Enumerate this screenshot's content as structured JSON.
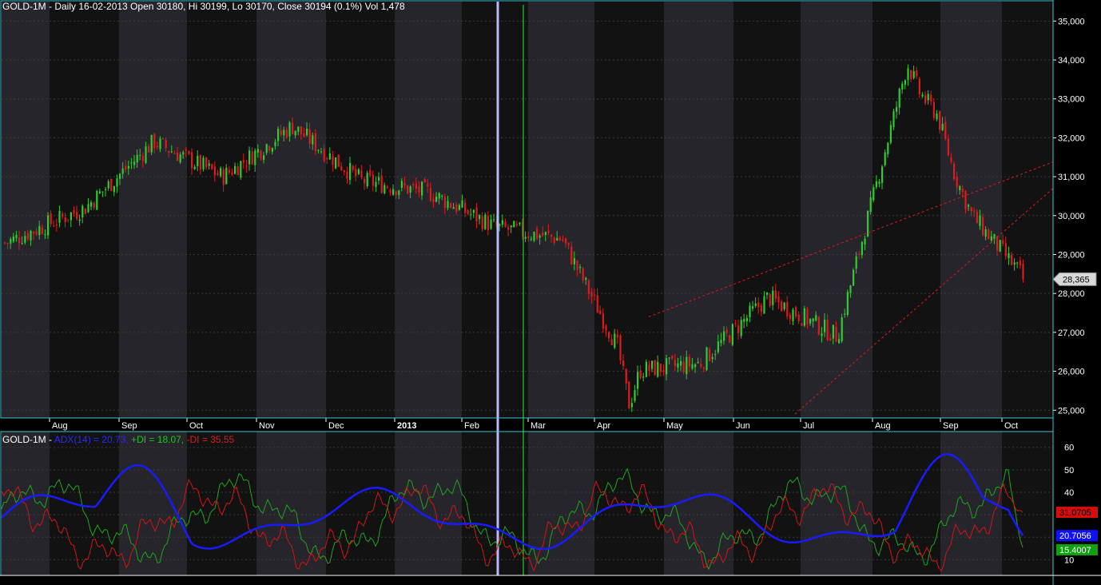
{
  "main": {
    "header": "GOLD-1M - Daily 16-02-2013 Open 30180, Hi 30199, Lo 30170, Close 30194 (0.1%) Vol 1,478",
    "last_price_label": "28,365"
  },
  "indicator": {
    "prefix": "GOLD-1M -",
    "adx_label": "ADX(14) = 20.73,",
    "pdi_label": "+DI = 18.07,",
    "mdi_label": "-DI = 35.55",
    "badge_mdi": "31.0705",
    "badge_adx": "20.7056",
    "badge_pdi": "15.4007"
  },
  "colors": {
    "background": "#000000",
    "band_light": "#26252b",
    "band_dark": "#121212",
    "border": "#39c8d2",
    "up": "#2ecc2e",
    "down": "#e01a1a",
    "adx": "#1a1aff",
    "pdi": "#1fa31f",
    "mdi": "#d41414",
    "vline1": "#b8b8ff",
    "vline2": "#22d022"
  },
  "chart_data": [
    {
      "type": "candlestick",
      "title": "GOLD-1M - Daily",
      "x_labels": [
        "Aug",
        "Sep",
        "Oct",
        "Nov",
        "Dec",
        "2013",
        "Feb",
        "Mar",
        "Apr",
        "May",
        "Jun",
        "Jul",
        "Aug",
        "Sep",
        "Oct"
      ],
      "y_ticks": [
        "25,000",
        "26,000",
        "27,000",
        "28,000",
        "29,000",
        "30,000",
        "31,000",
        "32,000",
        "33,000",
        "34,000",
        "35,000"
      ],
      "ylim": [
        24800,
        35500
      ],
      "close_path_by_month": [
        {
          "month": "Jul 2012",
          "close": 29300
        },
        {
          "month": "Aug 2012",
          "close": 30200
        },
        {
          "month": "Sep 2012",
          "close": 31900
        },
        {
          "month": "Oct 2012",
          "close": 31000
        },
        {
          "month": "Nov 2012",
          "close": 32300
        },
        {
          "month": "Dec 2012",
          "close": 30900
        },
        {
          "month": "Jan 2013",
          "close": 30600
        },
        {
          "month": "Feb 2013",
          "close": 29700
        },
        {
          "month": "Mar 2013",
          "close": 29400
        },
        {
          "month": "Apr 2013",
          "close": 26000
        },
        {
          "month": "May 2013",
          "close": 26200
        },
        {
          "month": "Jun 2013",
          "close": 27900
        },
        {
          "month": "Jul 2013",
          "close": 26900
        },
        {
          "month": "Aug 2013",
          "close": 33900
        },
        {
          "month": "Sep 2013",
          "close": 30000
        },
        {
          "month": "Oct 2013",
          "close": 28365
        }
      ],
      "last_close": 28365
    },
    {
      "type": "line",
      "title": "ADX(14)",
      "y_ticks": [
        "10",
        "20",
        "30",
        "40",
        "50",
        "60"
      ],
      "ylim": [
        3,
        67
      ],
      "series": [
        {
          "name": "ADX(14)",
          "last": 20.7056
        },
        {
          "name": "+DI",
          "last": 15.4007
        },
        {
          "name": "-DI",
          "last": 31.0705
        }
      ]
    }
  ]
}
